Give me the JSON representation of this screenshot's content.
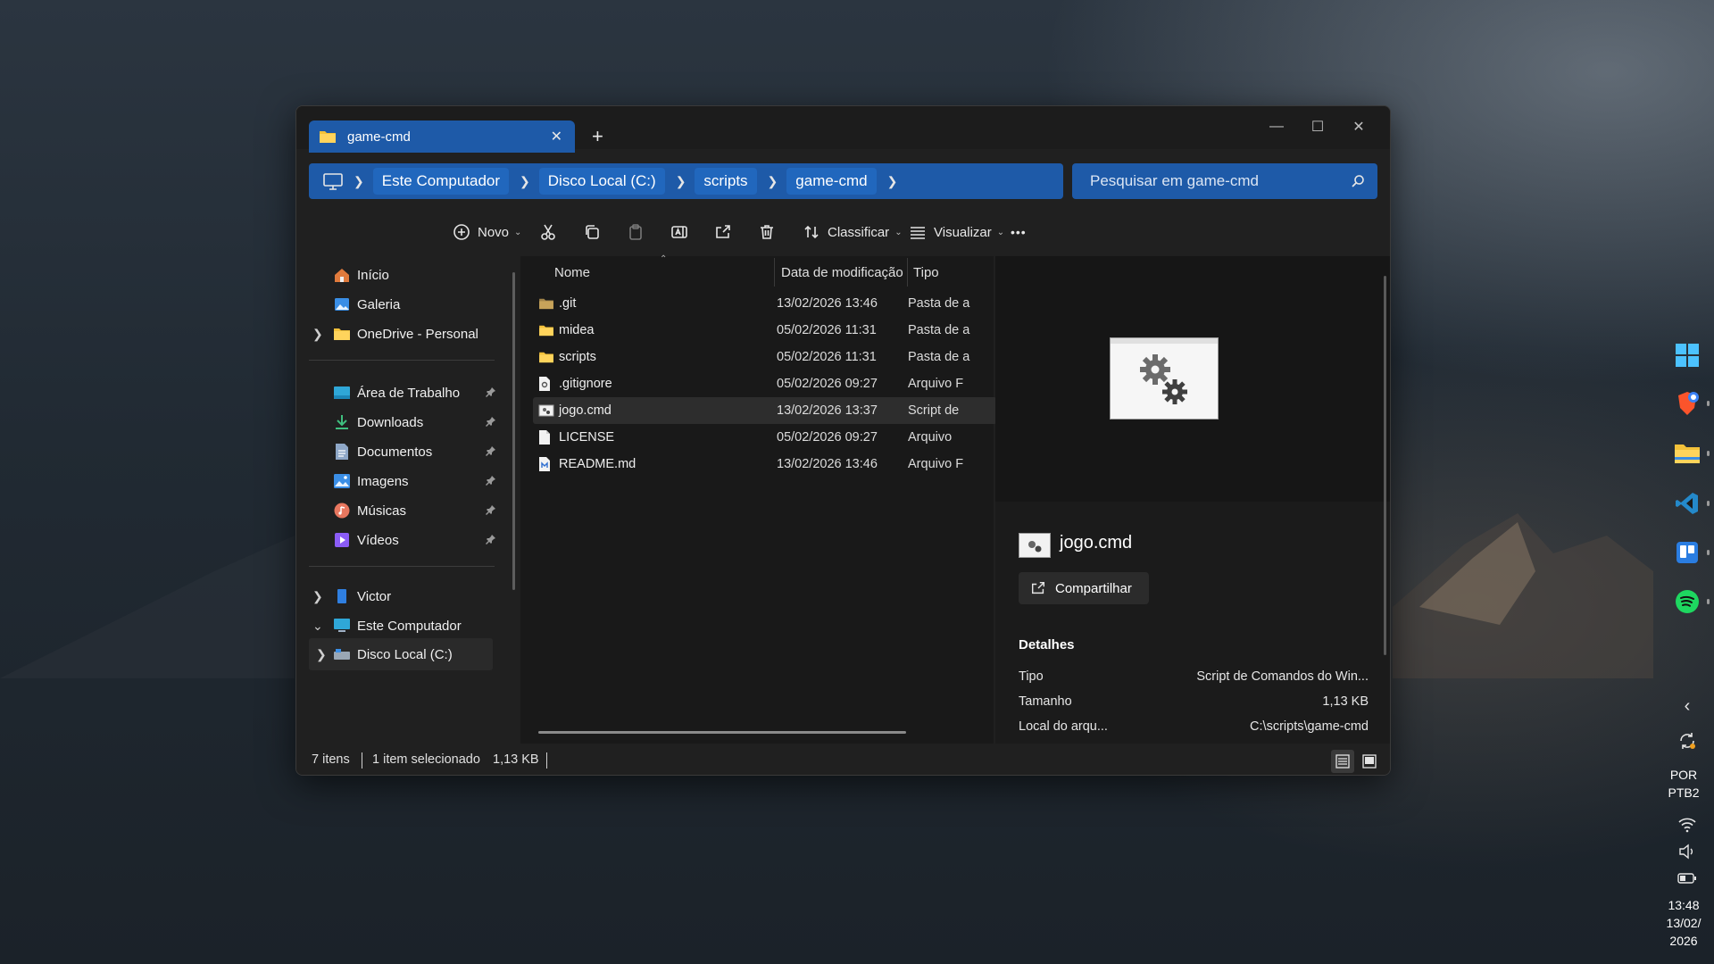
{
  "window": {
    "tab_title": "game-cmd",
    "new_tab": "+",
    "close_tab": "✕",
    "controls": {
      "minimize": "—",
      "maximize": "☐",
      "close": "✕"
    }
  },
  "address": {
    "crumbs": [
      "Este Computador",
      "Disco Local (C:)",
      "scripts",
      "game-cmd"
    ]
  },
  "search": {
    "placeholder": "Pesquisar em game-cmd"
  },
  "toolbar": {
    "new_label": "Novo",
    "sort_label": "Classificar",
    "view_label": "Visualizar",
    "more_label": "•••"
  },
  "sidebar": {
    "top": [
      {
        "label": "Início"
      },
      {
        "label": "Galeria"
      },
      {
        "label": "OneDrive - Personal"
      }
    ],
    "quick": [
      {
        "label": "Área de Trabalho"
      },
      {
        "label": "Downloads"
      },
      {
        "label": "Documentos"
      },
      {
        "label": "Imagens"
      },
      {
        "label": "Músicas"
      },
      {
        "label": "Vídeos"
      }
    ],
    "bottom": [
      {
        "label": "Victor"
      },
      {
        "label": "Este Computador"
      },
      {
        "label": "Disco Local (C:)"
      }
    ]
  },
  "filelist": {
    "columns": {
      "name": "Nome",
      "date": "Data de modificação",
      "type": "Tipo"
    },
    "rows": [
      {
        "name": ".git",
        "date": "13/02/2026 13:46",
        "type": "Pasta de a",
        "icon": "folder-icon"
      },
      {
        "name": "midea",
        "date": "05/02/2026 11:31",
        "type": "Pasta de a",
        "icon": "folder-icon"
      },
      {
        "name": "scripts",
        "date": "05/02/2026 11:31",
        "type": "Pasta de a",
        "icon": "folder-icon"
      },
      {
        "name": ".gitignore",
        "date": "05/02/2026 09:27",
        "type": "Arquivo F",
        "icon": "settings-file-icon"
      },
      {
        "name": "jogo.cmd",
        "date": "13/02/2026 13:37",
        "type": "Script de",
        "icon": "script-file-icon"
      },
      {
        "name": "LICENSE",
        "date": "05/02/2026 09:27",
        "type": "Arquivo",
        "icon": "blank-file-icon"
      },
      {
        "name": "README.md",
        "date": "13/02/2026 13:46",
        "type": "Arquivo F",
        "icon": "markdown-file-icon"
      }
    ]
  },
  "preview": {
    "title": "jogo.cmd",
    "share_label": "Compartilhar",
    "details_heading": "Detalhes",
    "details": [
      {
        "label": "Tipo",
        "value": "Script de Comandos do Win..."
      },
      {
        "label": "Tamanho",
        "value": "1,13 KB"
      },
      {
        "label": "Local do arqu...",
        "value": "C:\\scripts\\game-cmd"
      }
    ]
  },
  "status": {
    "count": "7 itens",
    "selection": "1 item selecionado",
    "size": "1,13 KB"
  },
  "tray": {
    "lang1": "POR",
    "lang2": "PTB2",
    "time": "13:48",
    "date1": "13/02/",
    "date2": "2026"
  },
  "colors": {
    "accent": "#1e5aa8",
    "folder": "#f3c13a",
    "window_bg": "#202020"
  }
}
